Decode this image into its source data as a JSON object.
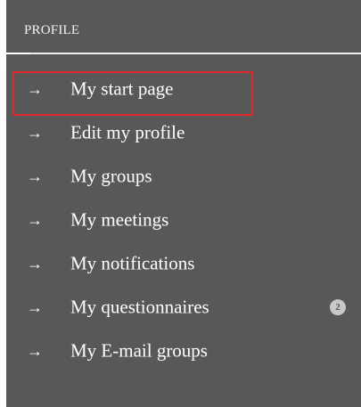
{
  "section": {
    "heading": "PROFILE"
  },
  "menu": {
    "arrow_glyph": "→",
    "items": [
      {
        "label": "My start page",
        "highlighted": true
      },
      {
        "label": "Edit my profile"
      },
      {
        "label": "My groups"
      },
      {
        "label": "My meetings"
      },
      {
        "label": "My notifications"
      },
      {
        "label": "My questionnaires",
        "badge": "2"
      },
      {
        "label": "My E-mail groups"
      }
    ]
  },
  "colors": {
    "panel_background": "#585858",
    "text": "#ffffff",
    "highlight_border": "#e0272b",
    "badge_background": "#c8c8c8"
  }
}
